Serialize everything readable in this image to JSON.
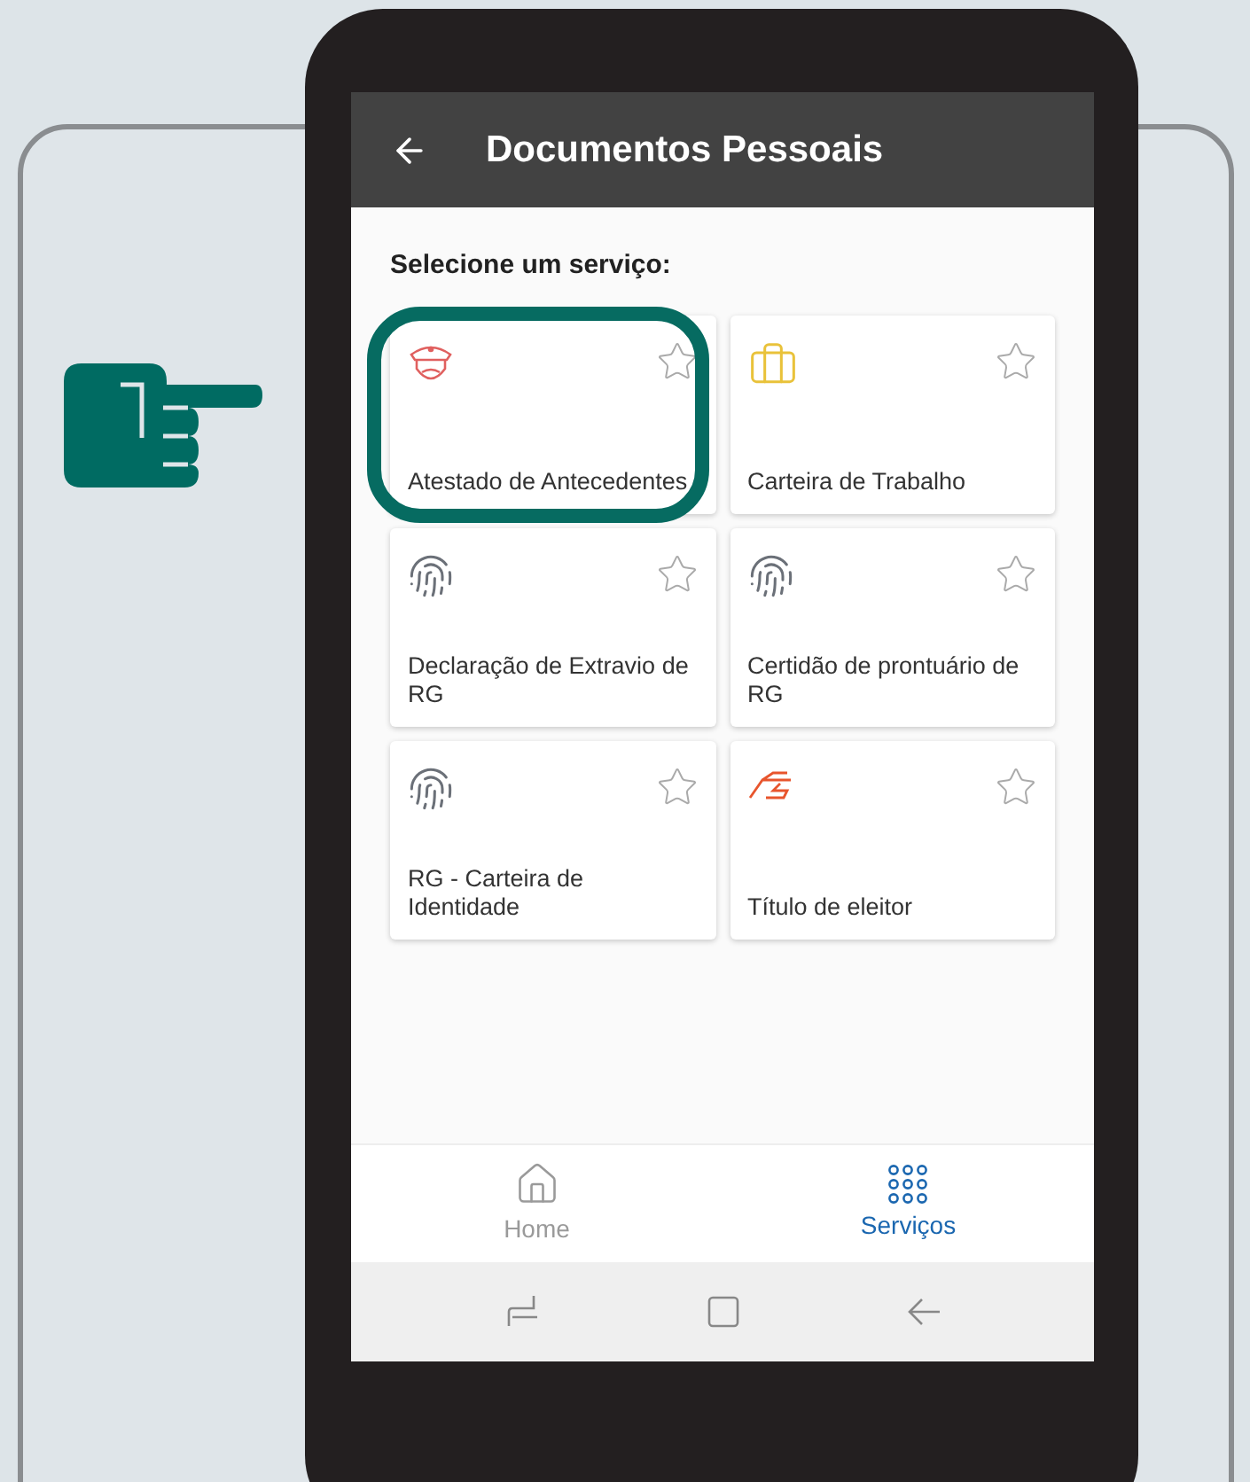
{
  "header": {
    "title": "Documentos Pessoais"
  },
  "prompt": "Selecione um serviço:",
  "services": [
    {
      "label": "Atestado de Antecedentes",
      "kind": "officer",
      "highlighted": true
    },
    {
      "label": "Carteira de Trabalho",
      "kind": "briefcase",
      "highlighted": false
    },
    {
      "label": "Declaração de Extravio de RG",
      "kind": "fingerprint",
      "highlighted": false
    },
    {
      "label": "Certidão de prontuário de RG",
      "kind": "fingerprint",
      "highlighted": false
    },
    {
      "label": "RG - Carteira de Identidade",
      "kind": "fingerprint",
      "highlighted": false
    },
    {
      "label": "Título de eleitor",
      "kind": "vote",
      "highlighted": false
    }
  ],
  "bottom_nav": [
    {
      "label": "Home",
      "kind": "home",
      "selected": false
    },
    {
      "label": "Serviços",
      "kind": "grid",
      "selected": true
    }
  ]
}
